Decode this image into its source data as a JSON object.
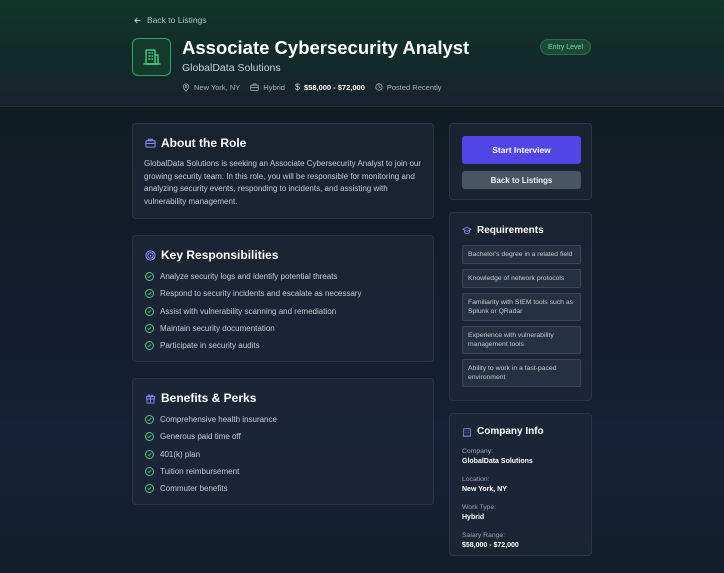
{
  "header": {
    "back_label": "Back to Listings",
    "title": "Associate Cybersecurity Analyst",
    "company": "GlobalData Solutions",
    "badge": "Entry Level",
    "meta": {
      "location": "New York, NY",
      "work_type": "Hybrid",
      "salary": "$58,000 - $72,000",
      "posted": "Posted Recently"
    }
  },
  "about": {
    "title": "About the Role",
    "text": "GlobalData Solutions is seeking an Associate Cybersecurity Analyst to join our growing security team. In this role, you will be responsible for monitoring and analyzing security events, responding to incidents, and assisting with vulnerability management."
  },
  "responsibilities": {
    "title": "Key Responsibilities",
    "items": [
      "Analyze security logs and identify potential threats",
      "Respond to security incidents and escalate as necessary",
      "Assist with vulnerability scanning and remediation",
      "Maintain security documentation",
      "Participate in security audits"
    ]
  },
  "benefits": {
    "title": "Benefits & Perks",
    "items": [
      "Comprehensive health insurance",
      "Generous paid time off",
      "401(k) plan",
      "Tuition reimbursement",
      "Commuter benefits"
    ]
  },
  "actions": {
    "start_label": "Start Interview",
    "back_label": "Back to Listings"
  },
  "requirements": {
    "title": "Requirements",
    "items": [
      "Bachelor's degree in a related field",
      "Knowledge of network protocols",
      "Familiarity with SIEM tools such as Splunk or QRadar",
      "Experience with vulnerability management tools",
      "Ability to work in a fast-paced environment"
    ]
  },
  "company_info": {
    "title": "Company Info",
    "company_label": "Company:",
    "company": "GlobalData Solutions",
    "location_label": "Location:",
    "location": "New York, NY",
    "work_type_label": "Work Type:",
    "work_type": "Hybrid",
    "salary_label": "Salary Range:",
    "salary": "$58,000 - $72,000"
  },
  "colors": {
    "accent": "#4f46e5",
    "success": "#3fcf85",
    "badge_text": "#6fe0a4"
  },
  "icons": [
    "arrow-left-icon",
    "building-icon",
    "map-pin-icon",
    "briefcase-icon",
    "dollar-icon",
    "clock-icon",
    "target-icon",
    "check-circle-icon",
    "gift-icon",
    "graduation-cap-icon"
  ]
}
